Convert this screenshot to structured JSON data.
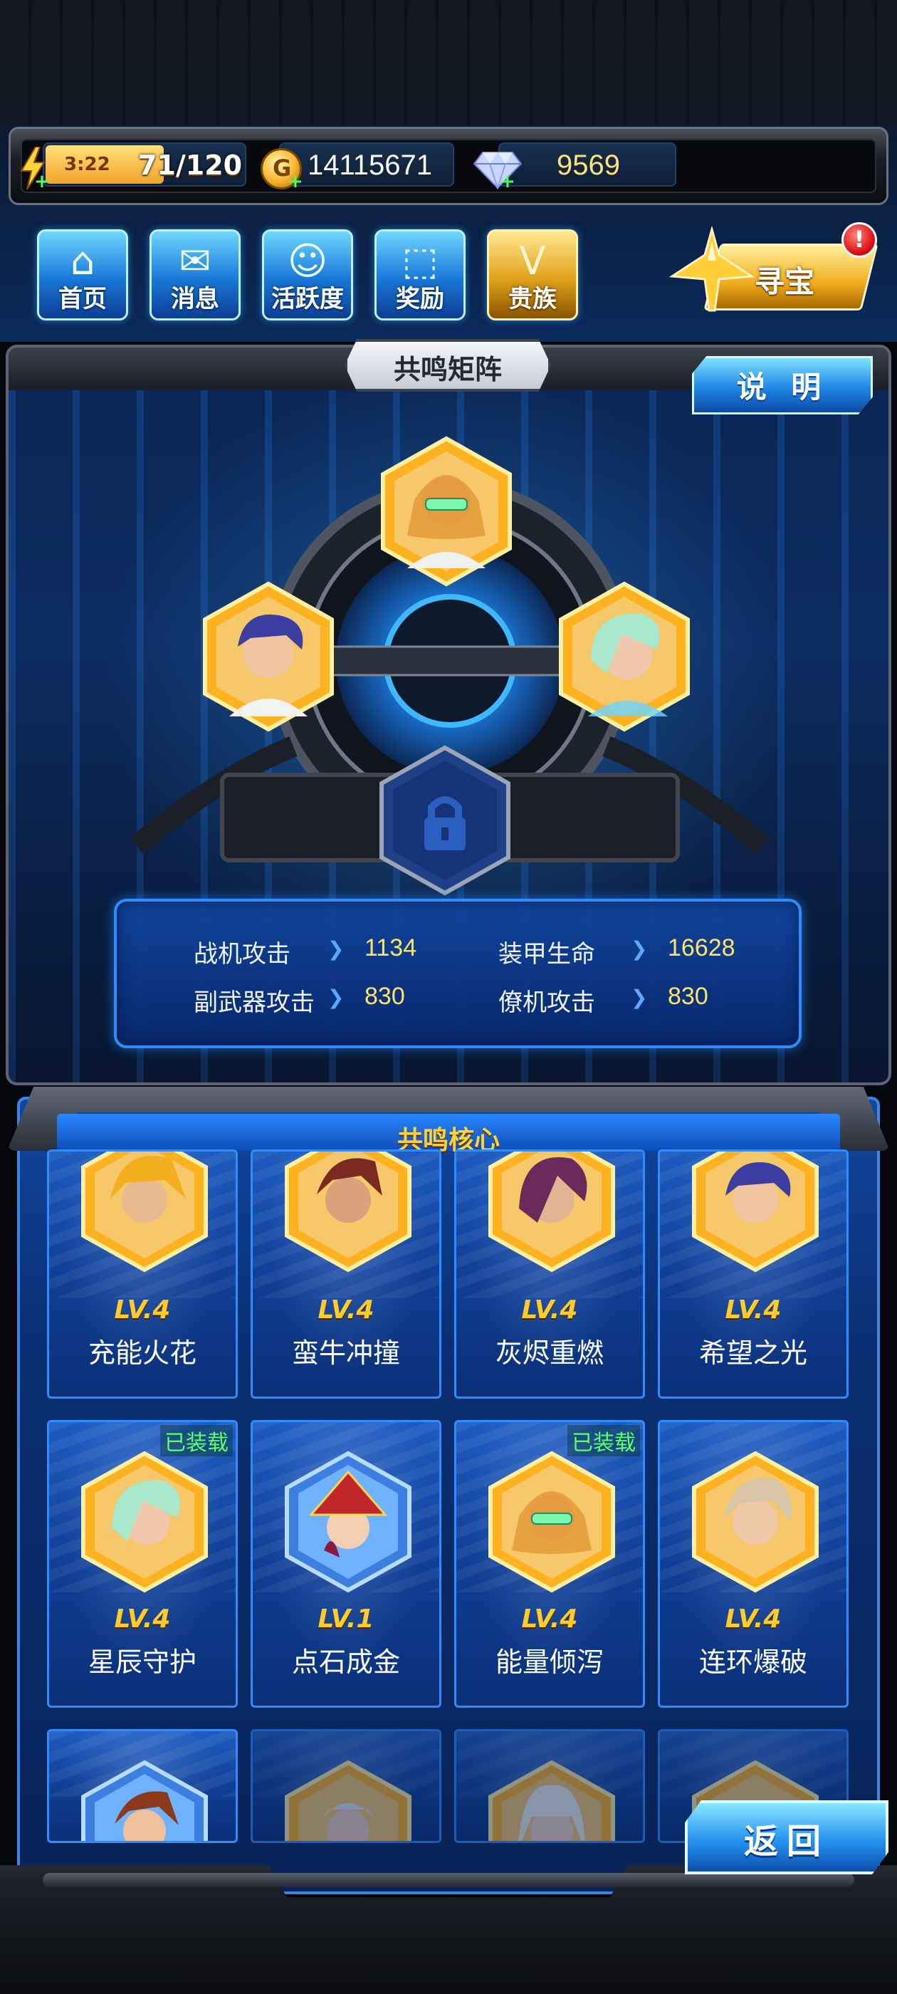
{
  "resources": {
    "energy_timer": "3:22",
    "energy_value": "71/120",
    "energy_fraction": 0.59,
    "gold": "14115671",
    "gems": "9569"
  },
  "nav": [
    {
      "label": "首页",
      "icon": "home-icon"
    },
    {
      "label": "消息",
      "icon": "message-icon"
    },
    {
      "label": "活跃度",
      "icon": "activity-icon"
    },
    {
      "label": "奖励",
      "icon": "gift-icon"
    },
    {
      "label": "贵族",
      "icon": "vip-icon"
    }
  ],
  "treasure": {
    "label": "寻宝",
    "badge": "!"
  },
  "matrix": {
    "title": "共鸣矩阵",
    "explain_label": "说 明"
  },
  "stats": [
    {
      "name": "战机攻击",
      "value": "1134"
    },
    {
      "name": "装甲生命",
      "value": "16628"
    },
    {
      "name": "副武器攻击",
      "value": "830"
    },
    {
      "name": "僚机攻击",
      "value": "830"
    }
  ],
  "core": {
    "title": "共鸣核心",
    "cards": [
      {
        "level": "LV.4",
        "name": "充能火花",
        "equipped": ""
      },
      {
        "level": "LV.4",
        "name": "蛮牛冲撞",
        "equipped": ""
      },
      {
        "level": "LV.4",
        "name": "灰烬重燃",
        "equipped": ""
      },
      {
        "level": "LV.4",
        "name": "希望之光",
        "equipped": ""
      },
      {
        "level": "LV.4",
        "name": "星辰守护",
        "equipped": "已装载"
      },
      {
        "level": "LV.1",
        "name": "点石成金",
        "equipped": ""
      },
      {
        "level": "LV.4",
        "name": "能量倾泻",
        "equipped": "已装载"
      },
      {
        "level": "LV.4",
        "name": "连环爆破",
        "equipped": ""
      }
    ]
  },
  "back_label": "返回",
  "colors": {
    "accent_gold": "#ffcc2a",
    "equipped_green": "#5dff6a",
    "frame_blue": "#2f8cff"
  }
}
